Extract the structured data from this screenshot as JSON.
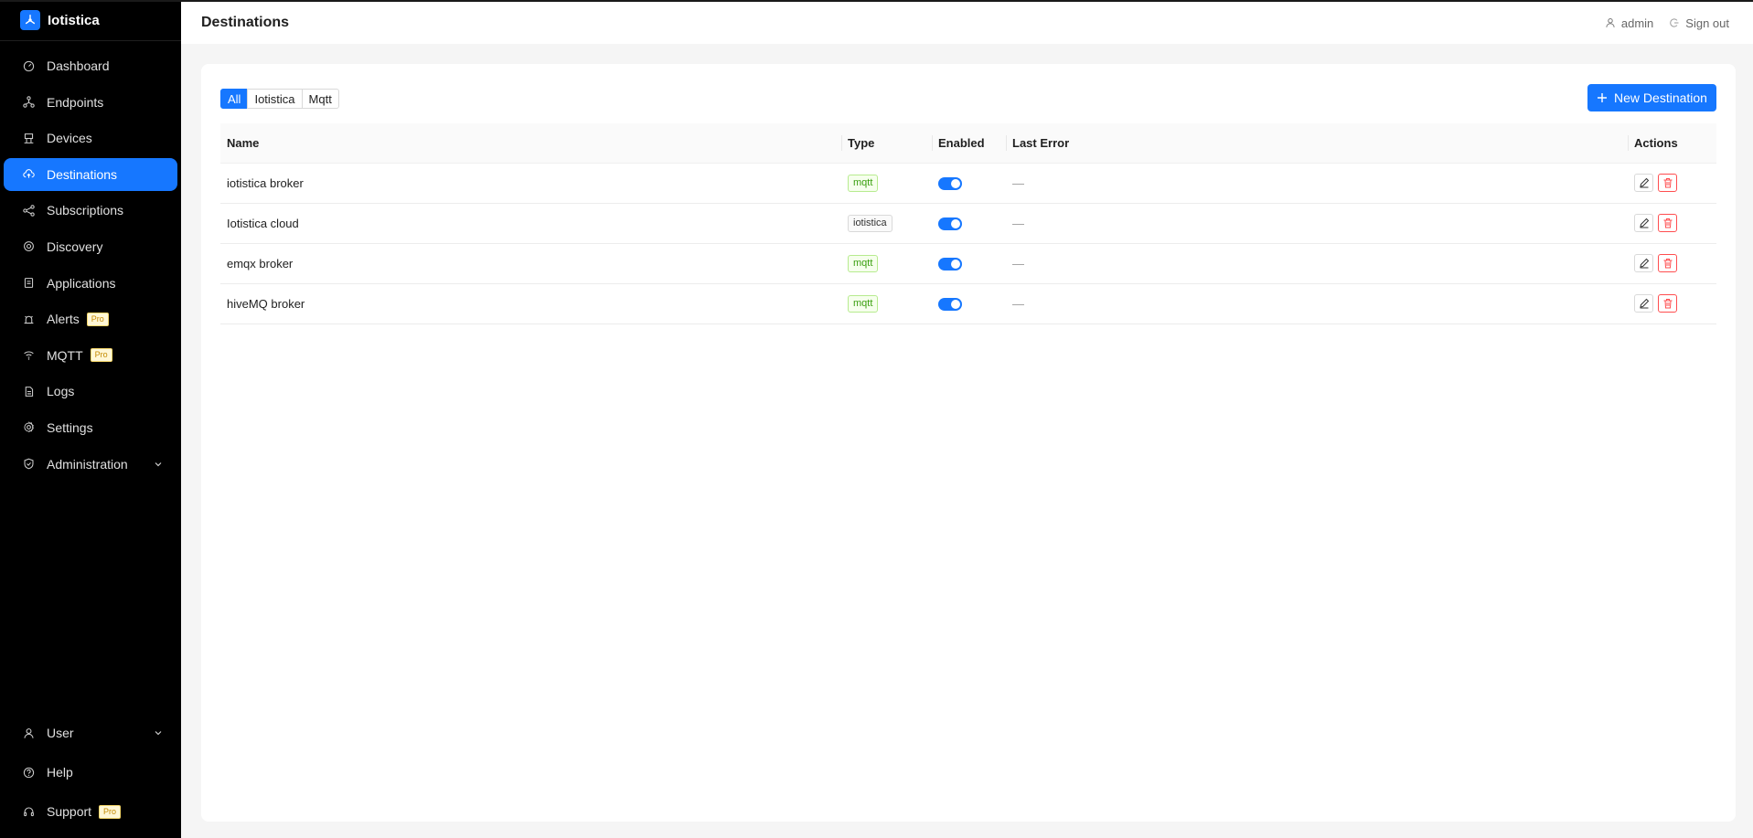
{
  "brand": {
    "name": "Iotistica"
  },
  "sidebar": {
    "items": [
      {
        "label": "Dashboard",
        "icon": "dashboard-icon"
      },
      {
        "label": "Endpoints",
        "icon": "endpoints-icon"
      },
      {
        "label": "Devices",
        "icon": "devices-icon"
      },
      {
        "label": "Destinations",
        "icon": "cloud-upload-icon",
        "active": true
      },
      {
        "label": "Subscriptions",
        "icon": "subscriptions-icon"
      },
      {
        "label": "Discovery",
        "icon": "discovery-icon"
      },
      {
        "label": "Applications",
        "icon": "applications-icon"
      },
      {
        "label": "Alerts",
        "icon": "alarm-icon",
        "badge": "Pro"
      },
      {
        "label": "MQTT",
        "icon": "wifi-icon",
        "badge": "Pro"
      },
      {
        "label": "Logs",
        "icon": "file-icon"
      },
      {
        "label": "Settings",
        "icon": "gear-icon"
      },
      {
        "label": "Administration",
        "icon": "shield-icon"
      }
    ],
    "bottom": [
      {
        "label": "User",
        "icon": "user-icon"
      },
      {
        "label": "Help",
        "icon": "question-icon"
      },
      {
        "label": "Support",
        "icon": "headset-icon",
        "badge": "Pro"
      }
    ]
  },
  "header": {
    "title": "Destinations",
    "user": "admin",
    "signout": "Sign out"
  },
  "filters": [
    "All",
    "Iotistica",
    "Mqtt"
  ],
  "new_button": "New Destination",
  "table": {
    "columns": [
      "Name",
      "Type",
      "Enabled",
      "Last Error",
      "Actions"
    ],
    "rows": [
      {
        "name": "iotistica broker",
        "type": "mqtt",
        "enabled": true,
        "last_error": "—"
      },
      {
        "name": "Iotistica cloud",
        "type": "iotistica",
        "enabled": true,
        "last_error": "—"
      },
      {
        "name": "emqx broker",
        "type": "mqtt",
        "enabled": true,
        "last_error": "—"
      },
      {
        "name": "hiveMQ broker",
        "type": "mqtt",
        "enabled": true,
        "last_error": "—"
      }
    ]
  },
  "colors": {
    "accent": "#1677ff",
    "sidebar_bg": "#000000",
    "danger": "#ff4d4f",
    "tag_green": "#389e0d"
  }
}
